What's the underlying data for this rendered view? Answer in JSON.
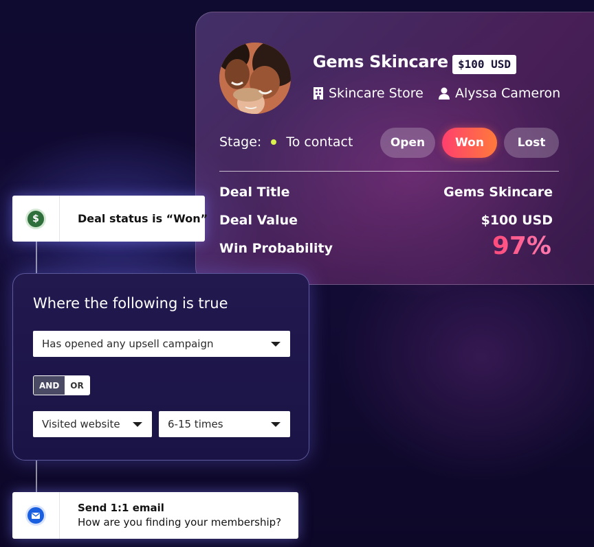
{
  "deal": {
    "name": "Gems Skincare",
    "price_badge": "$100 USD",
    "category": "Skincare Store",
    "contact": "Alyssa Cameron",
    "stage_label": "Stage:",
    "stage_value": "To contact",
    "stage_dot_color": "#d9f24c",
    "status_options": [
      "Open",
      "Won",
      "Lost"
    ],
    "selected_status": "Won",
    "accent_gradient": [
      "#ff3f6e",
      "#ff7a3a"
    ],
    "fields": [
      {
        "label": "Deal Title",
        "value": "Gems Skincare"
      },
      {
        "label": "Deal Value",
        "value": "$100 USD"
      },
      {
        "label": "Win Probability",
        "value": "97%"
      }
    ]
  },
  "workflow": {
    "trigger": {
      "icon": "dollar-icon",
      "text": "Deal status is “Won”"
    },
    "condition": {
      "title": "Where the following is true",
      "first_select": "Has opened any upsell campaign",
      "logic_options": [
        "AND",
        "OR"
      ],
      "logic_selected": "AND",
      "second_select": "Visited website",
      "third_select": "6-15 times"
    },
    "action": {
      "icon": "email-icon",
      "title": "Send 1:1 email",
      "subtitle": "How are you finding your membership?"
    }
  }
}
